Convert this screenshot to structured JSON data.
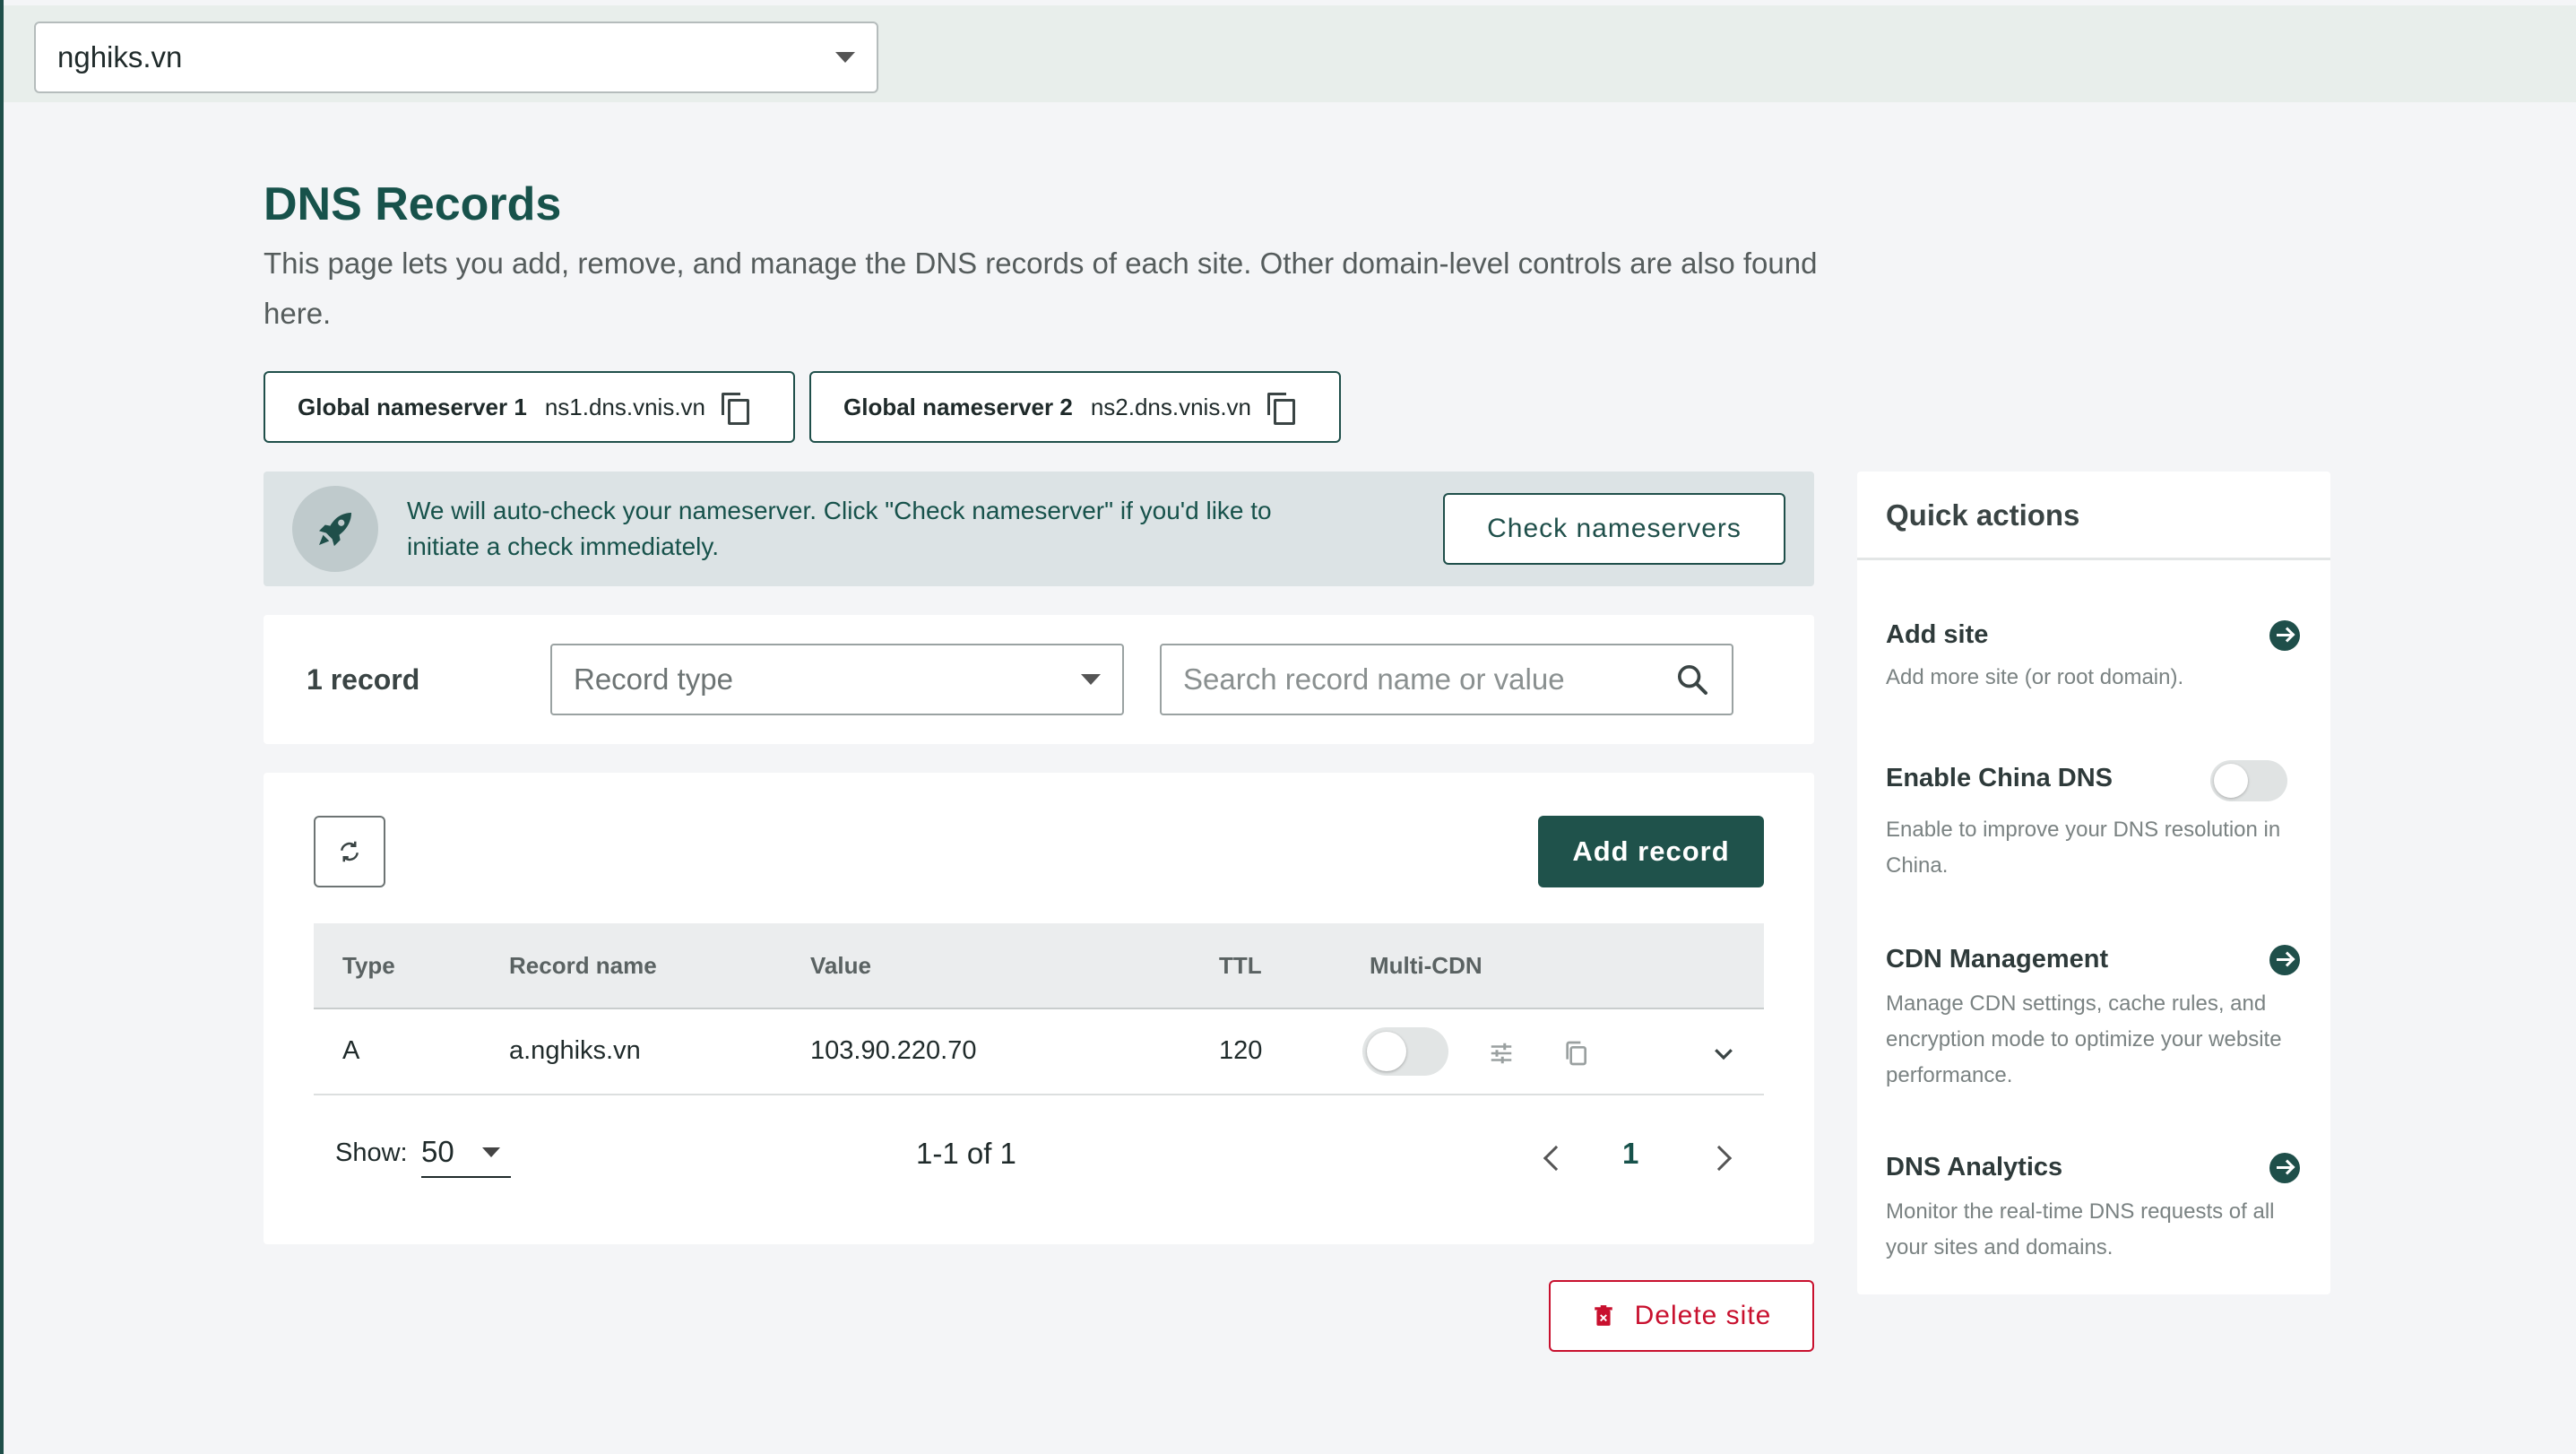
{
  "site_selector": {
    "value": "nghiks.vn"
  },
  "page": {
    "title": "DNS Records",
    "description": "This page lets you add, remove, and manage the DNS records of each site. Other domain-level controls are also found here."
  },
  "nameservers": [
    {
      "label": "Global nameserver  1",
      "value": "ns1.dns.vnis.vn"
    },
    {
      "label": "Global nameserver  2",
      "value": "ns2.dns.vnis.vn"
    }
  ],
  "notice": {
    "text": "We will auto-check your nameserver. Click \"Check nameserver\" if you'd like to initiate a check immediately.",
    "button": "Check nameservers"
  },
  "filters": {
    "record_count": "1 record",
    "record_type_placeholder": "Record type",
    "search_placeholder": "Search record name or value"
  },
  "table": {
    "add_button": "Add record",
    "columns": [
      "Type",
      "Record name",
      "Value",
      "TTL",
      "Multi-CDN"
    ],
    "rows": [
      {
        "type": "A",
        "name": "a.nghiks.vn",
        "value": "103.90.220.70",
        "ttl": "120",
        "multi_cdn": false
      }
    ]
  },
  "pagination": {
    "show_label": "Show:",
    "page_size": "50",
    "range": "1-1 of 1",
    "current_page": "1"
  },
  "delete_button": "Delete site",
  "quick_actions": {
    "title": "Quick actions",
    "items": [
      {
        "title": "Add site",
        "description": "Add more site (or root domain)."
      },
      {
        "title": "Enable China DNS",
        "description": "Enable to improve your DNS resolution in China.",
        "enabled": false
      },
      {
        "title": "CDN Management",
        "description": "Manage CDN settings, cache rules, and encryption mode to optimize your website performance."
      },
      {
        "title": "DNS Analytics",
        "description": "Monitor the real-time DNS requests of all your sites and domains."
      }
    ]
  },
  "colors": {
    "brand": "#1f524b",
    "danger": "#c8102e",
    "notice_bg": "#dce3e5"
  },
  "icons": [
    "chevron-down-icon",
    "copy-icon",
    "rocket-icon",
    "search-icon",
    "refresh-icon",
    "settings-sliders-icon",
    "trash-icon",
    "arrow-right-icon",
    "chevron-left-icon",
    "chevron-right-icon"
  ]
}
